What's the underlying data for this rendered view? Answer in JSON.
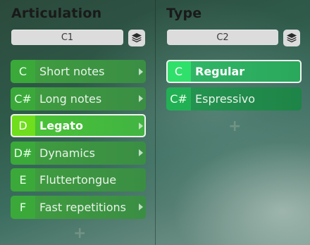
{
  "articulation": {
    "title": "Articulation",
    "channel": "C1",
    "layers_icon": "layers-icon",
    "items": [
      {
        "key": "C",
        "label": "Short notes",
        "has_arrow": true,
        "selected": false
      },
      {
        "key": "C#",
        "label": "Long notes",
        "has_arrow": true,
        "selected": false
      },
      {
        "key": "D",
        "label": "Legato",
        "has_arrow": true,
        "selected": true
      },
      {
        "key": "D#",
        "label": "Dynamics",
        "has_arrow": true,
        "selected": false
      },
      {
        "key": "E",
        "label": "Fluttertongue",
        "has_arrow": false,
        "selected": false
      },
      {
        "key": "F",
        "label": "Fast repetitions",
        "has_arrow": true,
        "selected": false
      }
    ],
    "add_label": "+"
  },
  "type": {
    "title": "Type",
    "channel": "C2",
    "layers_icon": "layers-icon",
    "items": [
      {
        "key": "C",
        "label": "Regular",
        "has_arrow": false,
        "selected": true
      },
      {
        "key": "C#",
        "label": "Espressivo",
        "has_arrow": false,
        "selected": false
      }
    ],
    "add_label": "+"
  },
  "colors": {
    "articulation_row": "#3c9a3c",
    "articulation_selected_key": "#6fde1c",
    "type_row": "#1f8c4c",
    "type_selected_key": "#2fe06a",
    "channel_field": "#dcdcdc"
  }
}
